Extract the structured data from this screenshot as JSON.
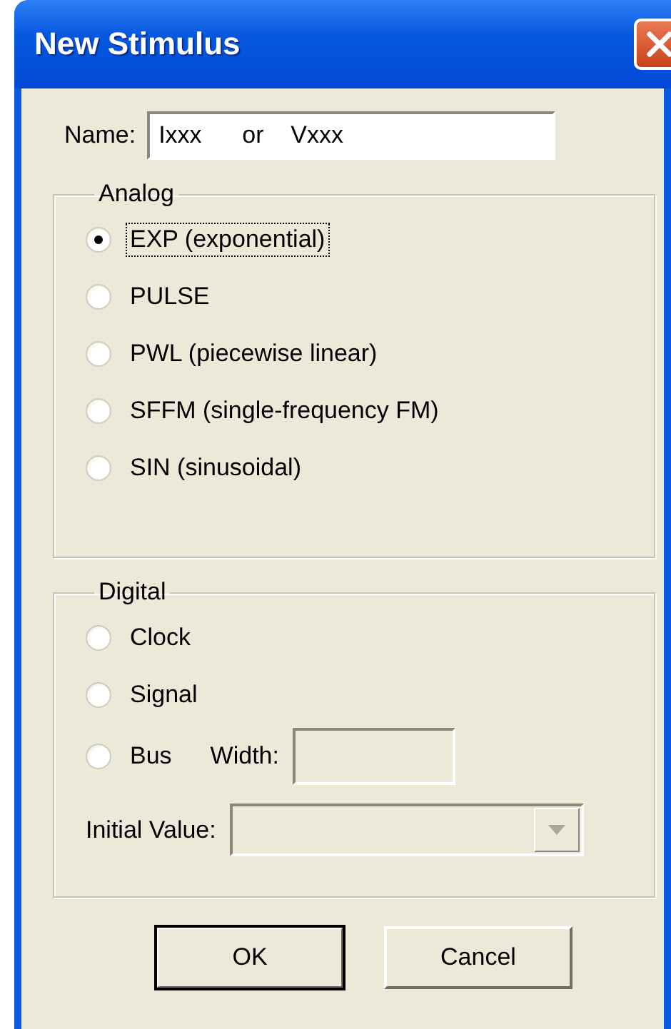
{
  "window": {
    "title": "New Stimulus"
  },
  "name_field": {
    "label": "Name:",
    "value": "Ixxx      or    Vxxx"
  },
  "analog": {
    "title": "Analog",
    "options": [
      {
        "label": "EXP (exponential)",
        "selected": true,
        "focused": true
      },
      {
        "label": "PULSE",
        "selected": false,
        "focused": false
      },
      {
        "label": "PWL (piecewise linear)",
        "selected": false,
        "focused": false
      },
      {
        "label": "SFFM (single-frequency FM)",
        "selected": false,
        "focused": false
      },
      {
        "label": "SIN (sinusoidal)",
        "selected": false,
        "focused": false
      }
    ]
  },
  "digital": {
    "title": "Digital",
    "options": [
      {
        "label": "Clock",
        "selected": false
      },
      {
        "label": "Signal",
        "selected": false
      },
      {
        "label": "Bus",
        "selected": false
      }
    ],
    "width_field": {
      "label": "Width:",
      "disabled": true
    },
    "initial_value": {
      "label": "Initial Value:",
      "disabled": true
    }
  },
  "buttons": [
    {
      "label": "OK",
      "default": true
    },
    {
      "label": "Cancel",
      "default": false
    }
  ]
}
